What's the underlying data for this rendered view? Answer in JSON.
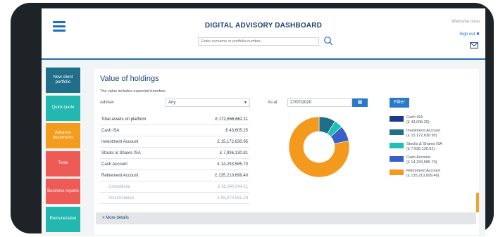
{
  "header": {
    "title": "DIGITAL ADVISORY DASHBOARD",
    "search_placeholder": "Enter surname or portfolio number...",
    "welcome": "Welcome oooo",
    "sign_out": "Sign out ✖"
  },
  "nav": [
    {
      "label": "New client portfolio",
      "color": "#1f6f8b"
    },
    {
      "label": "Quick quote",
      "color": "#22b8b0"
    },
    {
      "label": "Advance documents",
      "color": "#f39c1e"
    },
    {
      "label": "Tools",
      "color": "#ee5a55"
    },
    {
      "label": "Business reports",
      "color": "#ee5a55"
    },
    {
      "label": "Remuneration",
      "color": "#22b8b0"
    }
  ],
  "card": {
    "title": "Value of holdings",
    "subtitle": "The value includes expected transfers",
    "adviser_label": "Adviser",
    "adviser_value": "Any",
    "asat_label": "As at",
    "date_value": "27/07/2020",
    "filter_label": "Filter",
    "more_details": "> More details"
  },
  "table": [
    {
      "label": "Total assets on platform",
      "value": "£ 172,656,662.11",
      "kind": "total"
    },
    {
      "label": "Cash ISA",
      "value": "£ 43,605.25",
      "kind": "row"
    },
    {
      "label": "Investment Account",
      "value": "£ 15,172,630.95",
      "kind": "row"
    },
    {
      "label": "Stocks & Shares ISA",
      "value": "£ 7,936,130.81",
      "kind": "row"
    },
    {
      "label": "Cash Account",
      "value": "£ 14,293,585.70",
      "kind": "row"
    },
    {
      "label": "Retirement Account",
      "value": "£ 135,210,699.40",
      "kind": "row"
    },
    {
      "label": "Crystallised",
      "value": "£ 36,340,044.11",
      "kind": "indent"
    },
    {
      "label": "Accumulation",
      "value": "£ 98,870,655.29",
      "kind": "indent"
    }
  ],
  "chart_data": {
    "type": "pie",
    "categories": [
      "Cash ISA",
      "Investment Account",
      "Stocks & Shares ISA",
      "Cash Account",
      "Retirement Account"
    ],
    "values": [
      43605.25,
      15172630.95,
      7936130.81,
      14293585.7,
      135210699.4
    ],
    "value_labels": [
      "(£ 43,605.25)",
      "(£ 15,172,630.95)",
      "(£ 7,936,130.81)",
      "(£ 14,293,585.70)",
      "(£ 135,210,699.40)"
    ],
    "colors": [
      "#1b3a8a",
      "#1e6f8e",
      "#1fc1b5",
      "#3a5fc8",
      "#f39a1e"
    ],
    "donut": true
  }
}
